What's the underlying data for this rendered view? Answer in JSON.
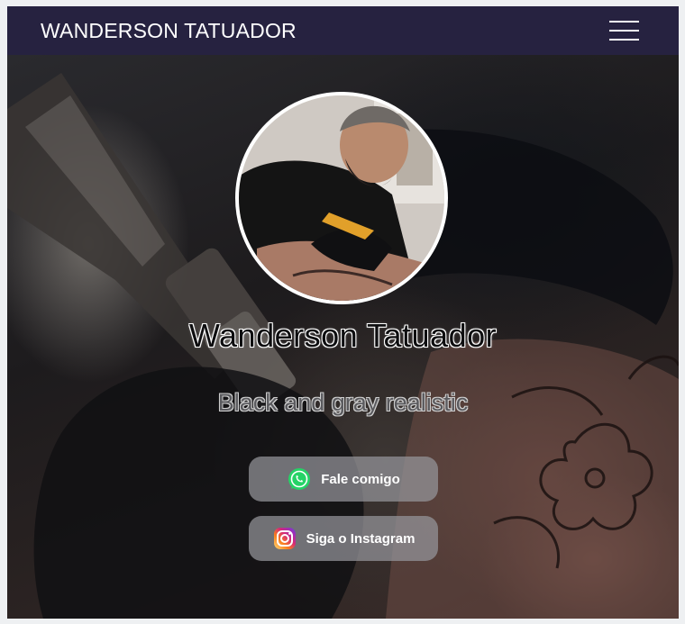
{
  "header": {
    "brand": "WANDERSON TATUADOR",
    "menu_icon": "hamburger-menu-icon"
  },
  "profile": {
    "name": "Wanderson Tatuador",
    "tagline": "Black and gray realistic"
  },
  "buttons": [
    {
      "label": "Fale comigo",
      "icon": "whatsapp-icon",
      "color": "#25D366"
    },
    {
      "label": "Siga o Instagram",
      "icon": "instagram-icon",
      "color": "#C13584"
    }
  ],
  "colors": {
    "topbar": "#262240",
    "button_bg": "rgba(150,150,155,0.72)"
  }
}
